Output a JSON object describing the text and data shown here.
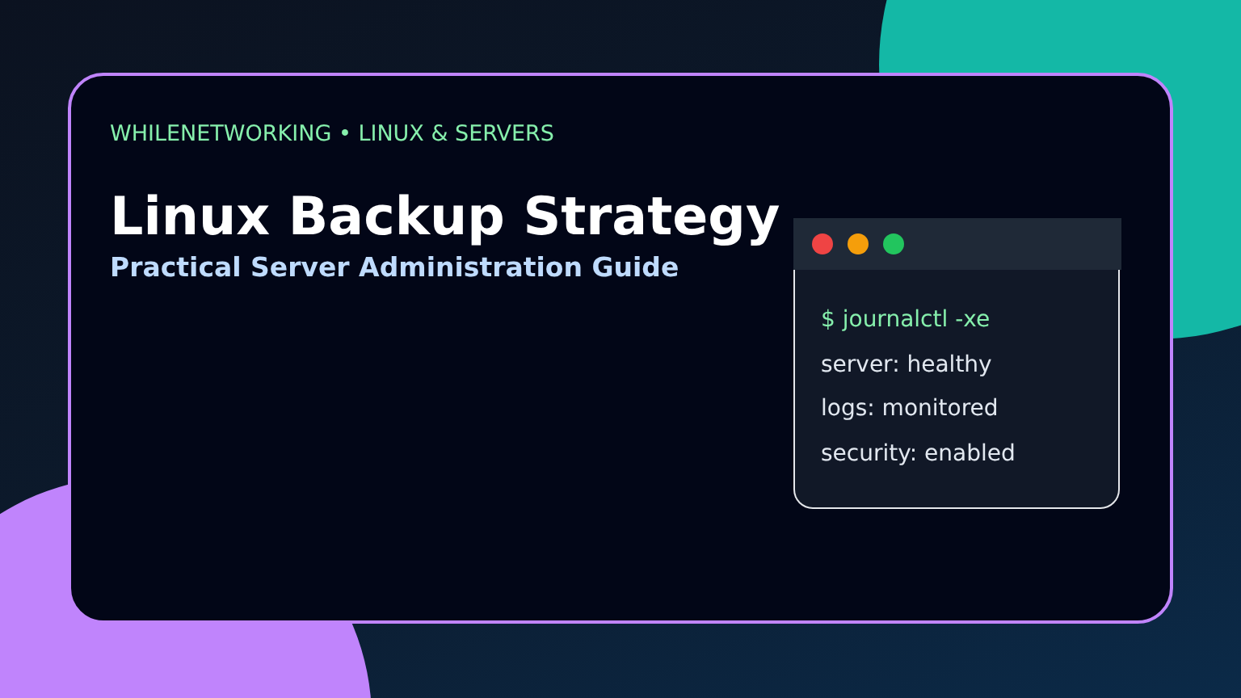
{
  "eyebrow": "WHILENETWORKING • LINUX & SERVERS",
  "title": "Linux Backup Strategy",
  "subtitle": "Practical Server Administration Guide",
  "terminal": {
    "lines": [
      {
        "kind": "command",
        "text": "$ journalctl -xe"
      },
      {
        "kind": "output",
        "text": "server: healthy"
      },
      {
        "kind": "output",
        "text": "logs: monitored"
      },
      {
        "kind": "output",
        "text": "security: enabled"
      }
    ]
  }
}
